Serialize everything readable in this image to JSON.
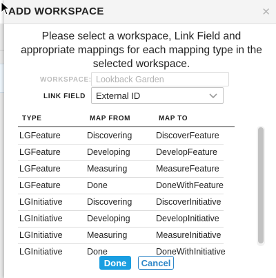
{
  "dialog": {
    "title": "ADD WORKSPACE",
    "close_icon": "close-icon",
    "instructions": "Please select a workspace, Link Field and appropriate mappings for each mapping type in the selected workspace."
  },
  "form": {
    "workspace_label": "WORKSPACE:",
    "workspace_value": "Lookback Garden",
    "link_field_label": "LINK FIELD",
    "link_field_value": "External ID",
    "link_field_icon": "chevron-down-icon"
  },
  "table": {
    "headers": [
      "TYPE",
      "MAP FROM",
      "MAP TO"
    ],
    "rows": [
      {
        "type": "LGFeature",
        "from": "Discovering",
        "to": "DiscoverFeature"
      },
      {
        "type": "LGFeature",
        "from": "Developing",
        "to": "DevelopFeature"
      },
      {
        "type": "LGFeature",
        "from": "Measuring",
        "to": "MeasureFeature"
      },
      {
        "type": "LGFeature",
        "from": "Done",
        "to": "DoneWithFeature"
      },
      {
        "type": "LGInitiative",
        "from": "Discovering",
        "to": "DiscoverInitiative"
      },
      {
        "type": "LGInitiative",
        "from": "Developing",
        "to": "DevelopInitiative"
      },
      {
        "type": "LGInitiative",
        "from": "Measuring",
        "to": "MeasureInitiative"
      },
      {
        "type": "LGInitiative",
        "from": "Done",
        "to": "DoneWithInitiative"
      }
    ]
  },
  "buttons": {
    "done_label": "Done",
    "cancel_label": "Cancel"
  },
  "colors": {
    "primary": "#1a9ee1",
    "link": "#2e86c8"
  }
}
